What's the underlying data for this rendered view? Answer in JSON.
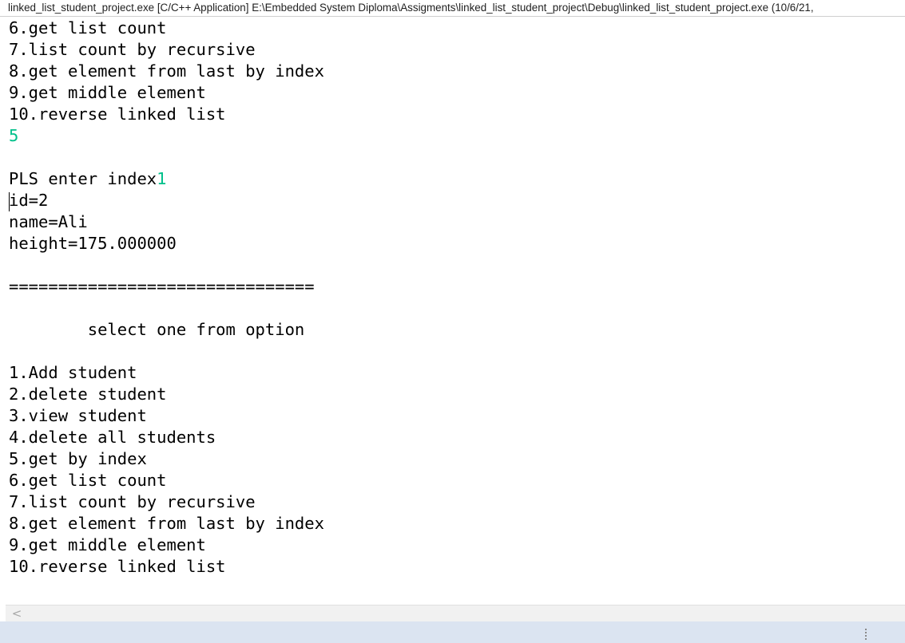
{
  "window": {
    "title": "linked_list_student_project.exe [C/C++ Application] E:\\Embedded System Diploma\\Assigments\\linked_list_student_project\\Debug\\linked_list_student_project.exe (10/6/21,"
  },
  "console": {
    "menu_top": [
      "6.get list count",
      "7.list count by recursive",
      "8.get element from last by index",
      "9.get middle element",
      "10.reverse linked list"
    ],
    "choice_input": "5",
    "prompt": "PLS enter index",
    "index_input": "1",
    "record": [
      "id=2",
      "name=Ali",
      "height=175.000000"
    ],
    "separator": "===============================",
    "heading": "        select one from option",
    "menu_bottom": [
      "1.Add student",
      "2.delete student",
      "3.view student",
      "4.delete all students",
      "5.get by index",
      "6.get list count",
      "7.list count by recursive",
      "8.get element from last by index",
      "9.get middle element",
      "10.reverse linked list"
    ],
    "input_color": "#00c08a"
  },
  "scrollbar": {
    "left_arrow_glyph": "<"
  }
}
